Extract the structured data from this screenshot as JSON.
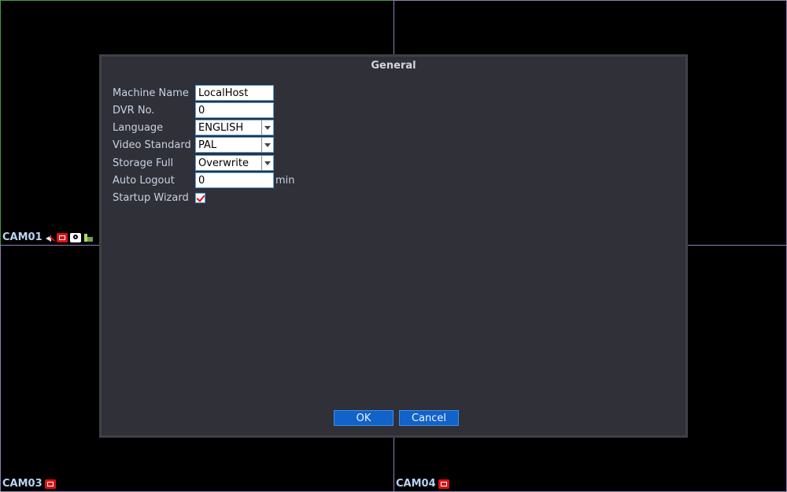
{
  "cameras": [
    {
      "label": "CAM01"
    },
    {
      "label": "CAM03"
    },
    {
      "label": "CAM04"
    }
  ],
  "dialog": {
    "title": "General",
    "fields": {
      "machine_name": {
        "label": "Machine Name",
        "value": "LocalHost"
      },
      "dvr_no": {
        "label": "DVR No.",
        "value": "0"
      },
      "language": {
        "label": "Language",
        "value": "ENGLISH"
      },
      "video_standard": {
        "label": "Video Standard",
        "value": "PAL"
      },
      "storage_full": {
        "label": "Storage Full",
        "value": "Overwrite"
      },
      "auto_logout": {
        "label": "Auto Logout",
        "value": "0",
        "unit": "min"
      },
      "startup_wizard": {
        "label": "Startup Wizard",
        "checked": true
      }
    },
    "buttons": {
      "ok": "OK",
      "cancel": "Cancel"
    }
  },
  "colors": {
    "dialog_bg": "#2f3038",
    "button_bg": "#1162c9",
    "active_tile_border": "#3fa03f",
    "tile_border": "#8f7fb5",
    "record_icon": "#dd1111"
  }
}
